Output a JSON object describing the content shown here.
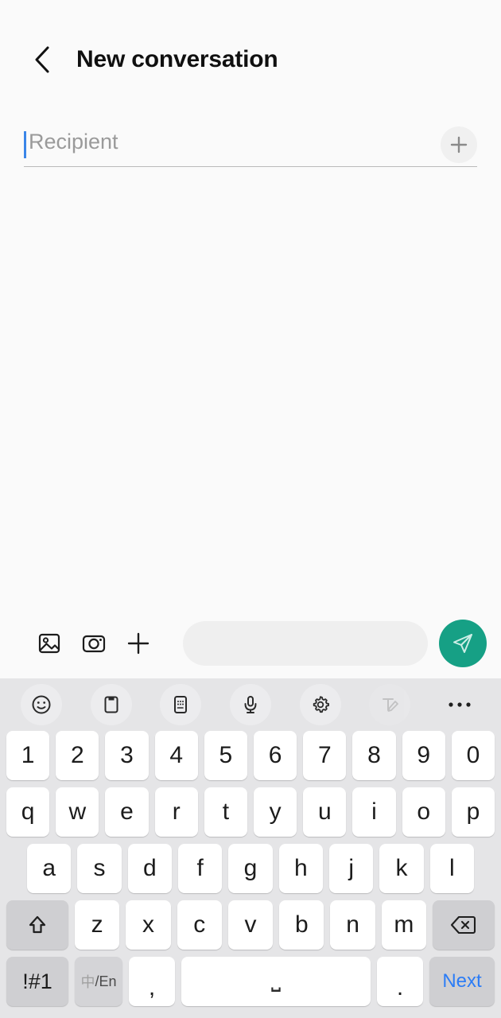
{
  "app": {
    "screen_title": "New conversation",
    "accent_send_color": "#16a085",
    "caret_color": "#3b86e8",
    "keyboard_bg_color": "#e5e5e7"
  },
  "header": {
    "back_icon": "chevron-left-icon",
    "title": "New conversation"
  },
  "recipient": {
    "placeholder": "Recipient",
    "value": "",
    "add_icon": "plus-icon",
    "add_label": "+"
  },
  "compose": {
    "gallery_icon": "image-icon",
    "camera_icon": "camera-icon",
    "attach_icon": "plus-icon",
    "message_placeholder": "",
    "message_value": "",
    "send_icon": "send-paper-plane-icon"
  },
  "keyboard": {
    "toolbar": [
      {
        "name": "emoji-icon",
        "label": "",
        "disabled": false,
        "flat": false
      },
      {
        "name": "clipboard-icon",
        "label": "",
        "disabled": false,
        "flat": false
      },
      {
        "name": "sticker-pad-icon",
        "label": "",
        "disabled": false,
        "flat": false
      },
      {
        "name": "microphone-icon",
        "label": "",
        "disabled": false,
        "flat": false
      },
      {
        "name": "settings-gear-icon",
        "label": "",
        "disabled": false,
        "flat": false
      },
      {
        "name": "handwriting-icon",
        "label": "",
        "disabled": true,
        "flat": false
      },
      {
        "name": "more-options-icon",
        "label": "",
        "disabled": false,
        "flat": true
      }
    ],
    "row_numbers": [
      "1",
      "2",
      "3",
      "4",
      "5",
      "6",
      "7",
      "8",
      "9",
      "0"
    ],
    "row_top": [
      "q",
      "w",
      "e",
      "r",
      "t",
      "y",
      "u",
      "i",
      "o",
      "p"
    ],
    "row_home": [
      "a",
      "s",
      "d",
      "f",
      "g",
      "h",
      "j",
      "k",
      "l"
    ],
    "row_bottom": [
      "z",
      "x",
      "c",
      "v",
      "b",
      "n",
      "m"
    ],
    "shift_label": "",
    "shift_icon": "shift-arrow-icon",
    "backspace_label": "",
    "backspace_icon": "backspace-icon",
    "symbols_label": "!#1",
    "language_label_cn": "中",
    "language_label_en": "/En",
    "comma_label": ",",
    "space_label": "⎵",
    "period_label": ".",
    "next_label": "Next"
  }
}
